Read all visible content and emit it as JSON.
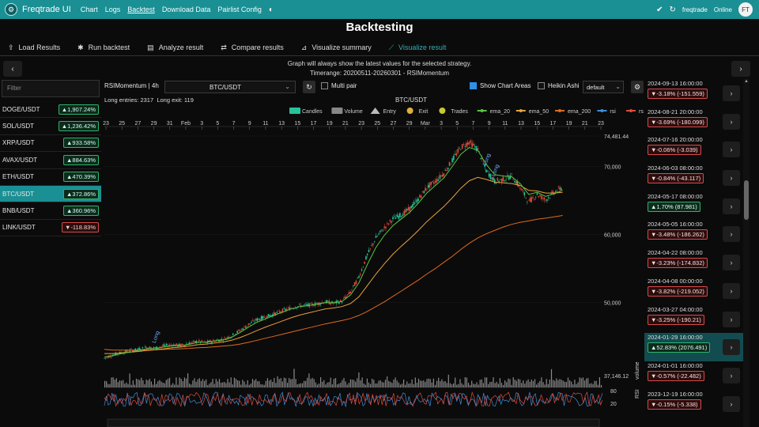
{
  "nav": {
    "brand": "Freqtrade UI",
    "links": [
      "Chart",
      "Logs",
      "Backtest",
      "Download Data",
      "Pairlist Config"
    ],
    "active_index": 2,
    "bot_name": "freqtrade",
    "status": "Online",
    "avatar": "FT"
  },
  "page_title": "Backtesting",
  "toolbar": {
    "items": [
      {
        "icon": "upload-icon",
        "label": "Load Results"
      },
      {
        "icon": "run-icon",
        "label": "Run backtest"
      },
      {
        "icon": "analyze-icon",
        "label": "Analyze result"
      },
      {
        "icon": "compare-icon",
        "label": "Compare results"
      },
      {
        "icon": "summary-icon",
        "label": "Visualize summary"
      },
      {
        "icon": "chart-line-icon",
        "label": "Visualize result"
      }
    ],
    "active_index": 5
  },
  "info": {
    "line1": "Graph will always show the latest values for the selected strategy.",
    "line2": "Timerange: 20200511-20260301 - RSIMomentum"
  },
  "filter_placeholder": "Filter",
  "pairs": [
    {
      "name": "DOGE/USDT",
      "value": "▲1,907.24%",
      "positive": true
    },
    {
      "name": "SOL/USDT",
      "value": "▲1,236.42%",
      "positive": true
    },
    {
      "name": "XRP/USDT",
      "value": "▲933.58%",
      "positive": true
    },
    {
      "name": "AVAX/USDT",
      "value": "▲884.63%",
      "positive": true
    },
    {
      "name": "ETH/USDT",
      "value": "▲470.39%",
      "positive": true
    },
    {
      "name": "BTC/USDT",
      "value": "▲372.86%",
      "positive": true
    },
    {
      "name": "BNB/USDT",
      "value": "▲360.96%",
      "positive": true
    },
    {
      "name": "LINK/USDT",
      "value": "▼-118.83%",
      "positive": false
    }
  ],
  "active_pair_index": 5,
  "chart_controls": {
    "strategy_tf": "RSIMomentum | 4h",
    "pair": "BTC/USDT",
    "multi_pair": "Multi pair",
    "show_chart_areas": "Show Chart Areas",
    "heikin_ashi": "Heikin Ashi",
    "layout": "default",
    "long_entries": "Long entries: 2317",
    "long_exit": "Long exit: 119"
  },
  "chart_data": {
    "type": "candlestick",
    "title": "BTC/USDT",
    "legend": [
      "Candles",
      "Volume",
      "Entry",
      "Exit",
      "Trades",
      "ema_20",
      "ema_50",
      "ema_200",
      "rsi",
      "rsi_ma"
    ],
    "legend_colors": [
      "#26c29a",
      "#888888",
      "#bbbbbb",
      "#e0b13a",
      "#c8c832",
      "#58c640",
      "#e8a23a",
      "#e06a1e",
      "#3b8fe0",
      "#e04a3a"
    ],
    "x_ticks": [
      "23",
      "25",
      "27",
      "29",
      "31",
      "Feb",
      "3",
      "5",
      "7",
      "9",
      "11",
      "13",
      "15",
      "17",
      "19",
      "21",
      "23",
      "25",
      "27",
      "29",
      "Mar",
      "3",
      "5",
      "7",
      "9",
      "11",
      "13",
      "15",
      "17",
      "19",
      "21",
      "23"
    ],
    "y_ticks": [
      "74,481.44",
      "70,000",
      "60,000",
      "50,000"
    ],
    "y_tick_values": [
      74481.44,
      70000,
      60000,
      50000
    ],
    "ylim": [
      41000,
      74481.44
    ],
    "volume_label": "volume",
    "volume_max": "37,146.12",
    "rsi_label": "RSI",
    "rsi_ticks": [
      "80",
      "20"
    ],
    "markers": [
      "Long",
      "Long",
      "Long"
    ],
    "close": [
      41800,
      42300,
      42600,
      42900,
      43100,
      43400,
      43300,
      43600,
      43800,
      43700,
      44000,
      44300,
      44100,
      44400,
      44600,
      45100,
      45900,
      46800,
      47500,
      47900,
      48300,
      48800,
      49200,
      49500,
      49600,
      49800,
      50100,
      49900,
      50200,
      51500,
      53800,
      57000,
      59500,
      61000,
      62300,
      62900,
      63800,
      65200,
      66900,
      67800,
      69000,
      70900,
      72800,
      73600,
      72500,
      69400,
      67800,
      68100,
      68600,
      66900,
      64800,
      65900,
      65100,
      66200,
      67000
    ],
    "ema_20": [
      42000,
      42200,
      42500,
      42700,
      42950,
      43200,
      43250,
      43450,
      43650,
      43650,
      43850,
      44150,
      44150,
      44350,
      44500,
      44900,
      45600,
      46400,
      47100,
      47600,
      48100,
      48600,
      49050,
      49400,
      49550,
      49750,
      50000,
      49950,
      50150,
      51100,
      52900,
      55600,
      58100,
      59900,
      61300,
      62300,
      63300,
      64600,
      66100,
      67200,
      68300,
      70000,
      71800,
      72800,
      72400,
      70300,
      68800,
      68600,
      68500,
      67500,
      65900,
      66200,
      65600,
      66000,
      66500
    ],
    "ema_50": [
      42500,
      42500,
      42600,
      42700,
      42800,
      42950,
      43050,
      43200,
      43350,
      43450,
      43600,
      43800,
      43900,
      44050,
      44200,
      44450,
      44850,
      45350,
      45900,
      46400,
      46850,
      47300,
      47750,
      48150,
      48450,
      48750,
      49050,
      49200,
      49400,
      49850,
      50850,
      52500,
      54200,
      55700,
      57100,
      58300,
      59400,
      60600,
      61900,
      63000,
      64100,
      65400,
      66800,
      67900,
      68400,
      68100,
      67700,
      67600,
      67500,
      67200,
      66500,
      66400,
      66100,
      66100,
      66200
    ],
    "ema_200": [
      43100,
      43000,
      43000,
      43000,
      43000,
      43000,
      43050,
      43100,
      43150,
      43200,
      43250,
      43350,
      43400,
      43500,
      43600,
      43700,
      43900,
      44150,
      44450,
      44750,
      45050,
      45350,
      45650,
      45950,
      46250,
      46550,
      46850,
      47100,
      47350,
      47650,
      48100,
      48700,
      49400,
      50100,
      50900,
      51700,
      52500,
      53300,
      54200,
      55000,
      55900,
      56800,
      57800,
      58700,
      59500,
      60100,
      60600,
      61100,
      61500,
      61800,
      62000,
      62250,
      62400,
      62600,
      62800
    ],
    "x_range_frac": [
      0.0,
      0.92
    ]
  },
  "trades": [
    {
      "date": "2024-09-13 16:00:00",
      "value": "▼-3.18% (-151.559)",
      "positive": false
    },
    {
      "date": "2024-08-21 20:00:00",
      "value": "▼-3.69% (-180.099)",
      "positive": false
    },
    {
      "date": "2024-07-16 20:00:00",
      "value": "▼-0.06% (-3.039)",
      "positive": false
    },
    {
      "date": "2024-06-03 08:00:00",
      "value": "▼-0.84% (-43.117)",
      "positive": false
    },
    {
      "date": "2024-05-17 08:00:00",
      "value": "▲1.70% (87.981)",
      "positive": true
    },
    {
      "date": "2024-05-05 16:00:00",
      "value": "▼-3.48% (-186.262)",
      "positive": false
    },
    {
      "date": "2024-04-22 08:00:00",
      "value": "▼-3.23% (-174.832)",
      "positive": false
    },
    {
      "date": "2024-04-08 00:00:00",
      "value": "▼-3.82% (-219.052)",
      "positive": false
    },
    {
      "date": "2024-03-27 04:00:00",
      "value": "▼-3.25% (-190.21)",
      "positive": false
    },
    {
      "date": "2024-01-29 16:00:00",
      "value": "▲52.83% (2076.491)",
      "positive": true
    },
    {
      "date": "2024-01-01 16:00:00",
      "value": "▼-0.57% (-22.482)",
      "positive": false
    },
    {
      "date": "2023-12-19 16:00:00",
      "value": "▼-0.15% (-5.338)",
      "positive": false
    }
  ],
  "active_trade_index": 9,
  "colors": {
    "accent": "#1a8f94",
    "positive": "#2fb36b",
    "negative": "#d84a4a"
  }
}
